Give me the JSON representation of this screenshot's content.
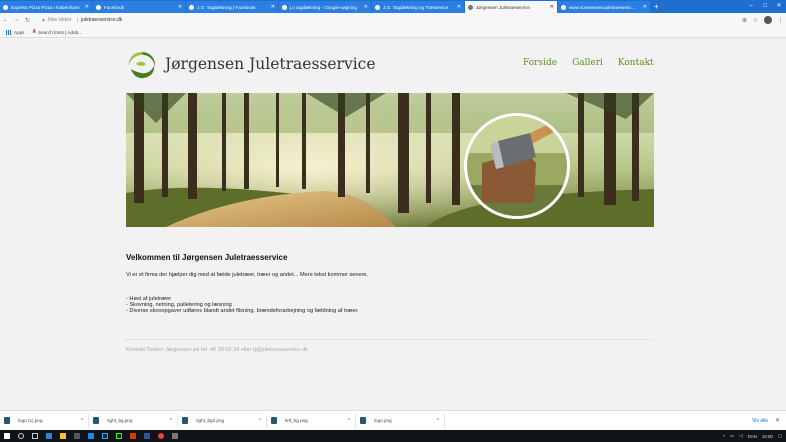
{
  "browser": {
    "tabs": [
      {
        "label": "Express Pizza Pizza i København",
        "active": false
      },
      {
        "label": "Facebook",
        "active": false
      },
      {
        "label": "J.O. Tagdækning | Facebook",
        "active": false
      },
      {
        "label": "j.o tagdækning - Google-søgning",
        "active": false
      },
      {
        "label": "J.O. Tagdækning og Træservice",
        "active": false
      },
      {
        "label": "Jørgensen Juletraeservice",
        "active": true
      },
      {
        "label": "www.vosserwww.juletraeservic…",
        "active": false
      }
    ],
    "address": {
      "security_label": "Ikke sikker",
      "separator": "|",
      "url": "juletraesservice.dk"
    },
    "bookmarks": [
      {
        "label": "Apps",
        "icon": "apps-grid-icon"
      },
      {
        "label": "Search fonts | Adob…",
        "icon": "adobe-icon"
      }
    ]
  },
  "site": {
    "title": "Jørgensen Juletraesservice",
    "nav": [
      "Forside",
      "Galleri",
      "Kontakt"
    ],
    "heading": "Velkommen til Jørgensen Juletraesservice",
    "intro": "Vi er et firma der hjælper dig med at fælde juletræer, træer og andet... Mere tekst kommer senere.",
    "services": [
      "- Høst af juletræer",
      "- Skovning, netning, palletering og læsning",
      "- Diverse skovopgaver udføres blandt andet flisning, brændeforarbejning og fældning af træer."
    ],
    "contact": "Kontakt Torben Jørgensen på tel. 40 28 02 34 eller tj@juletraesservice.dk",
    "colors": {
      "nav": "#5e8c26",
      "logo_dark": "#4a7d1e",
      "logo_light": "#9cc43c"
    }
  },
  "downloads": {
    "items": [
      "logo (1).png",
      "right_bg.png",
      "right_bg2.png",
      "left_bg.png",
      "logo.png"
    ],
    "show_all": "Vis alle"
  },
  "taskbar": {
    "lang": "DAN",
    "time": "10:00"
  }
}
